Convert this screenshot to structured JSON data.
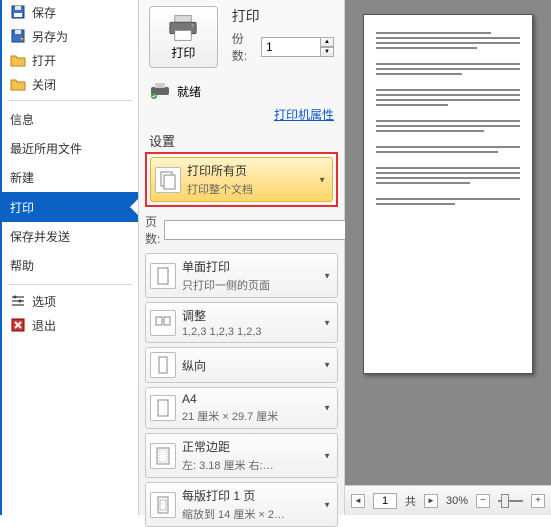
{
  "sidebar": {
    "items": [
      {
        "label": "保存",
        "icon": "save"
      },
      {
        "label": "另存为",
        "icon": "saveas"
      },
      {
        "label": "打开",
        "icon": "open"
      },
      {
        "label": "关闭",
        "icon": "close"
      }
    ],
    "sections": [
      {
        "label": "信息"
      },
      {
        "label": "最近所用文件"
      },
      {
        "label": "新建"
      },
      {
        "label": "打印",
        "selected": true
      },
      {
        "label": "保存并发送"
      },
      {
        "label": "帮助"
      }
    ],
    "footer": [
      {
        "label": "选项",
        "icon": "options"
      },
      {
        "label": "退出",
        "icon": "exit"
      }
    ]
  },
  "print": {
    "title": "打印",
    "button_label": "打印",
    "copies_label": "份数:",
    "copies_value": "1",
    "printer_status": "就绪",
    "printer_props_link": "打印机属性",
    "settings_label": "设置"
  },
  "highlighted": {
    "title": "打印所有页",
    "sub": "打印整个文档"
  },
  "pages": {
    "label": "页数:",
    "value": ""
  },
  "options": [
    {
      "title": "单面打印",
      "sub": "只打印一侧的页面",
      "icon": "single"
    },
    {
      "title": "调整",
      "sub": "1,2,3   1,2,3   1,2,3",
      "icon": "collate"
    },
    {
      "title": "纵向",
      "sub": "",
      "icon": "portrait"
    },
    {
      "title": "A4",
      "sub": "21 厘米 × 29.7 厘米",
      "icon": "a4"
    },
    {
      "title": "正常边距",
      "sub": "左: 3.18 厘米   右:…",
      "icon": "margins"
    },
    {
      "title": "每版打印 1 页",
      "sub": "缩放到 14 厘米 × 2…",
      "icon": "perpage"
    }
  ],
  "preview": {
    "current_page": "1",
    "total_label": "共",
    "zoom": "30%"
  }
}
